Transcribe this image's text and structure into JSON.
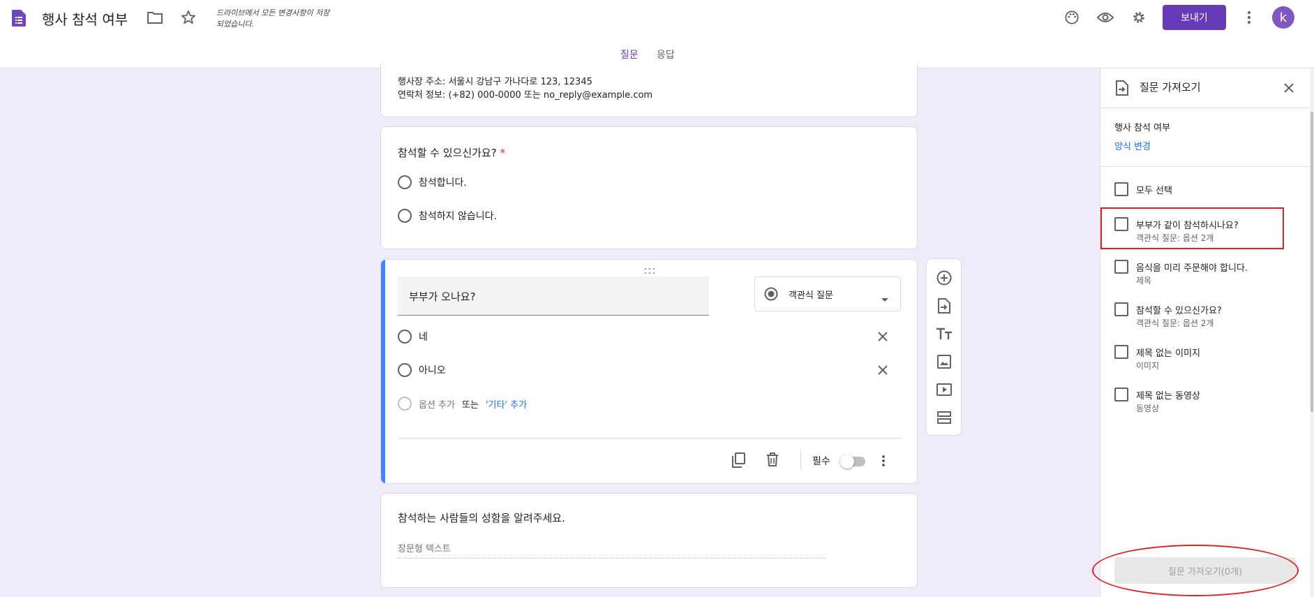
{
  "header": {
    "title": "행사 참석 여부",
    "save_status": "드라이브에서 모든 변경사항이 저장되었습니다.",
    "send_label": "보내기",
    "avatar_letter": "k",
    "tabs": [
      {
        "label": "질문",
        "active": true
      },
      {
        "label": "응답",
        "active": false
      }
    ]
  },
  "info_card": {
    "line1": "행사장 주소: 서울시 강남구 가나다로 123, 12345",
    "line2": "연락처 정보: (+82) 000-0000 또는 no_reply@example.com"
  },
  "attend_card": {
    "question": "참석할 수 있으신가요?",
    "required_mark": "*",
    "options": [
      "참석합니다.",
      "참석하지 않습니다."
    ]
  },
  "editing_card": {
    "question": "부부가 오나요?",
    "type_label": "객관식 질문",
    "options": [
      "네",
      "아니오"
    ],
    "add_option": "옵션 추가",
    "or_text": "또는",
    "add_other": "'기타' 추가",
    "required_label": "필수"
  },
  "names_card": {
    "question": "참석하는 사람들의 성함을 알려주세요.",
    "placeholder": "장문형 텍스트"
  },
  "panel": {
    "title": "질문 가져오기",
    "form_name": "행사 참석 여부",
    "change_form": "양식 변경",
    "select_all": "모두 선택",
    "items": [
      {
        "title": "부부가 같이 참석하시나요?",
        "sub": "객관식 질문: 옵션 2개"
      },
      {
        "title": "음식을 미리 주문해야 합니다.",
        "sub": "제목"
      },
      {
        "title": "참석할 수 있으신가요?",
        "sub": "객관식 질문: 옵션 2개"
      },
      {
        "title": "제목 없는 이미지",
        "sub": "이미지"
      },
      {
        "title": "제목 없는 동영상",
        "sub": "동영상"
      }
    ],
    "import_button": "질문 가져오기(0개)"
  },
  "colors": {
    "accent": "#673ab7",
    "background": "#f0ebf8",
    "highlight": "#e02020",
    "focus_bar": "#4285f4"
  }
}
